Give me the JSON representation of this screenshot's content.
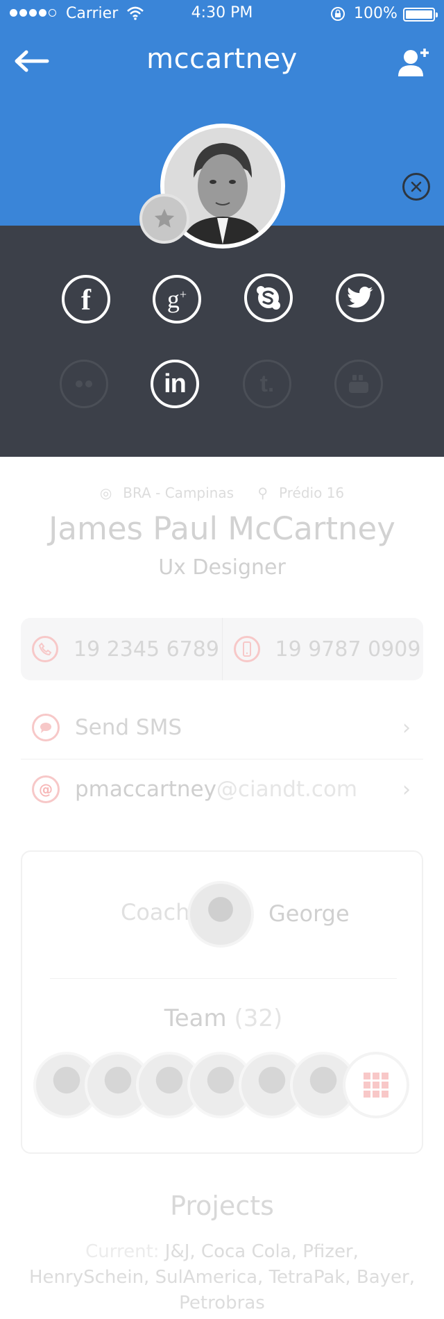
{
  "status_bar": {
    "carrier": "Carrier",
    "time": "4:30 PM",
    "battery": "100%"
  },
  "header": {
    "title": "mccartney"
  },
  "social": [
    "facebook-icon",
    "google-plus-icon",
    "skype-icon",
    "twitter-icon",
    "flickr-icon",
    "linkedin-icon",
    "tumblr-icon",
    "youtube-icon"
  ],
  "profile": {
    "country": "BRA - Campinas",
    "building": "Prédio 16",
    "name": "James Paul McCartney",
    "role": "Ux Designer"
  },
  "contacts": {
    "phone": "19 2345 6789",
    "mobile": "19 9787 0909",
    "sms_label": "Send SMS",
    "email_user": "pmaccartney",
    "email_domain": "@ciandt.com"
  },
  "team_card": {
    "coach_label": "Coach",
    "coach_name": "George",
    "team_label": "Team",
    "team_count": "(32)"
  },
  "projects": {
    "title": "Projects",
    "current_label": "Current:",
    "current_list": "J&J, Coca Cola, Pfizer, HenrySchein, SulAmerica, TetraPak, Bayer, Petrobras"
  },
  "colors": {
    "header_blue": "#3a85d8",
    "dark_panel": "#3c4049",
    "accent_pink": "#f7c8c8"
  }
}
